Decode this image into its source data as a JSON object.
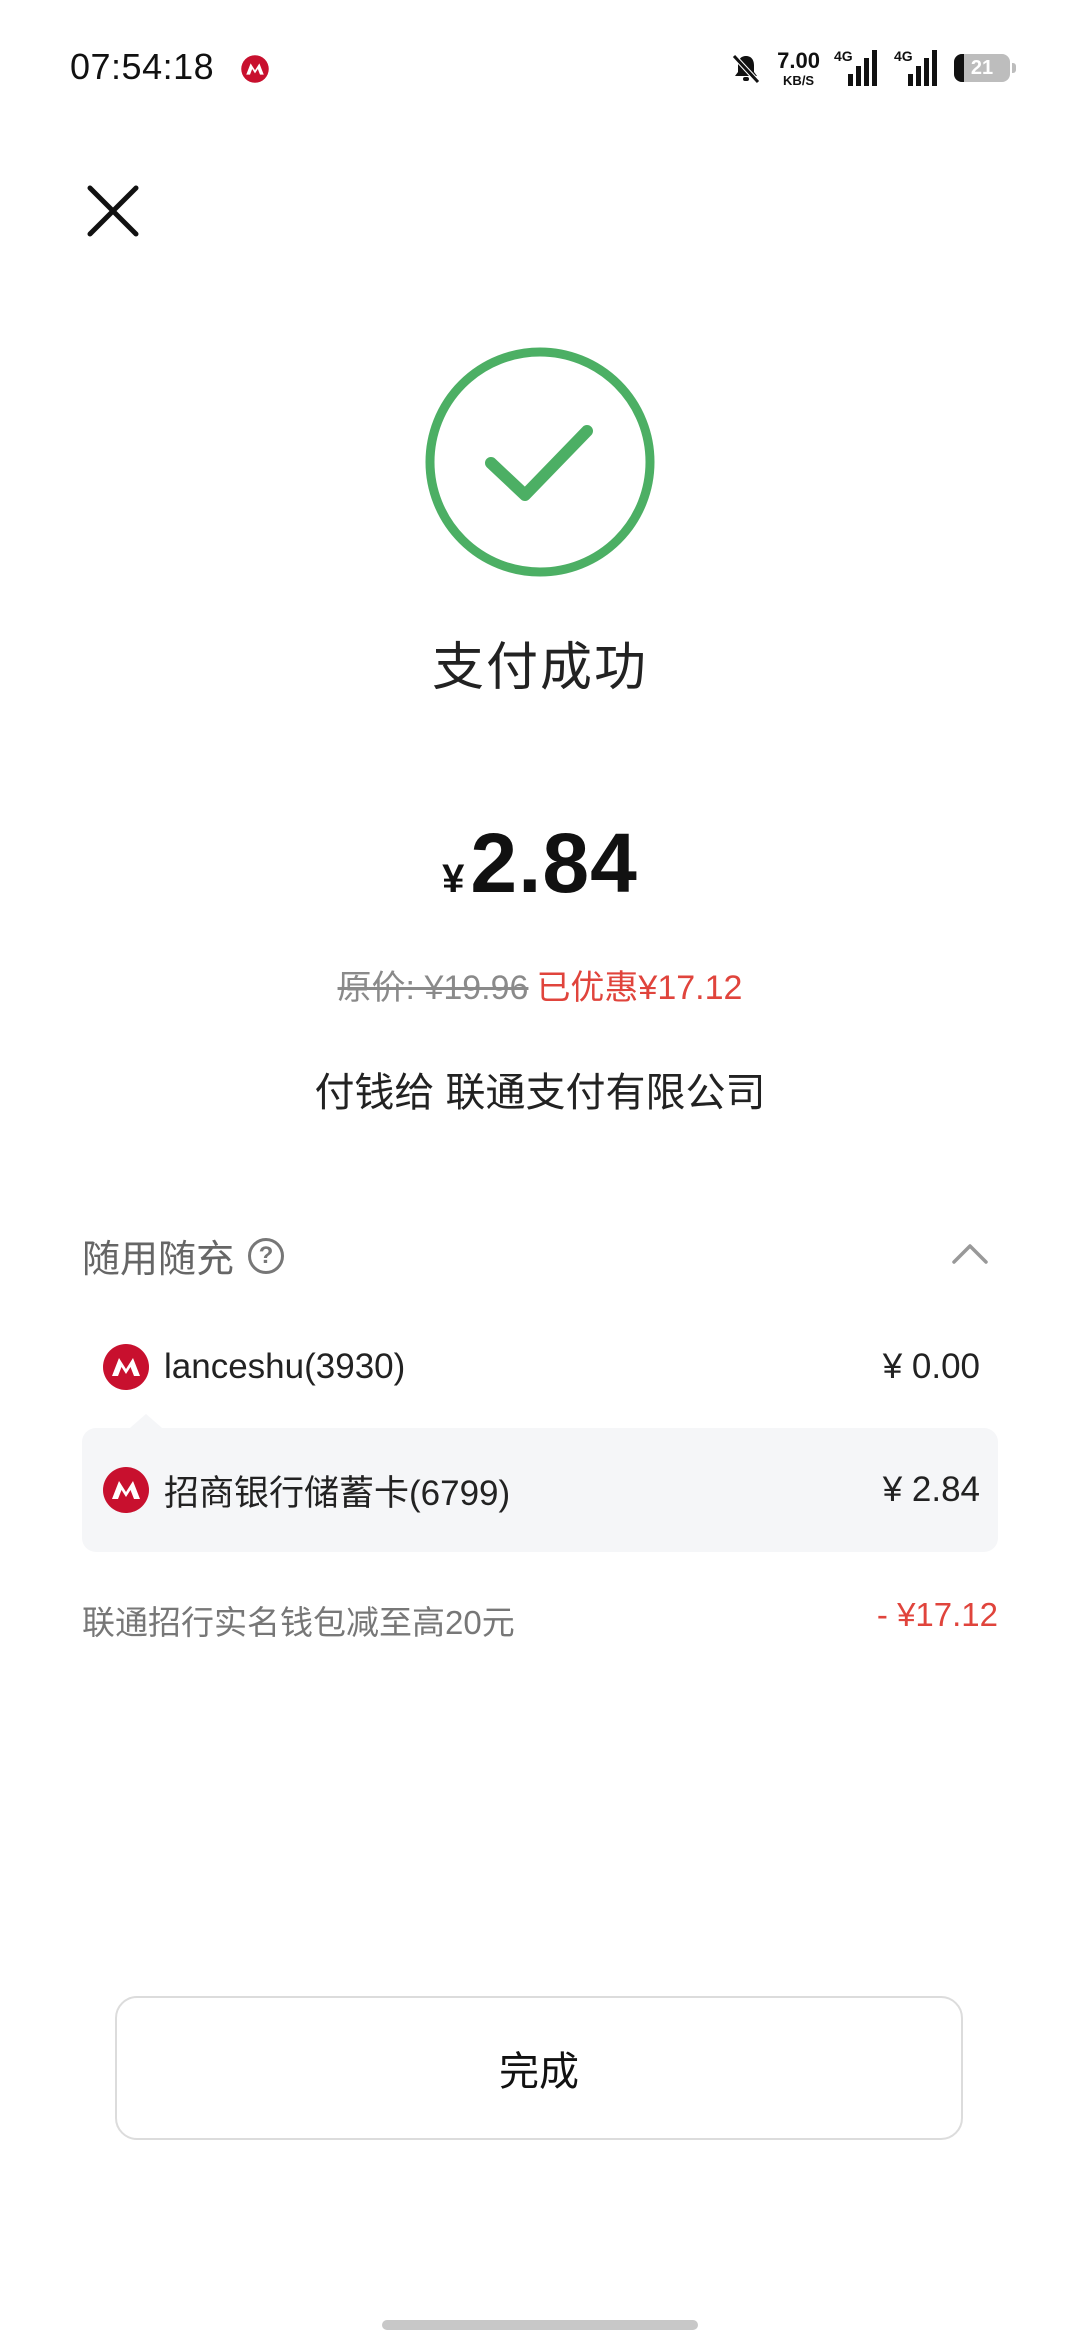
{
  "status_bar": {
    "time": "07:54:18",
    "net_speed_value": "7.00",
    "net_speed_unit": "KB/S",
    "signal1_tag": "4G",
    "signal2_tag": "4G",
    "battery_level": "21",
    "icons": [
      "cmb-logo-icon",
      "bell-muted-icon",
      "signal-icon",
      "signal-icon",
      "battery-icon"
    ]
  },
  "header": {
    "close_icon": "close-icon"
  },
  "result": {
    "icon": "check-circle-icon",
    "title": "支付成功",
    "currency": "¥",
    "amount": "2.84",
    "original_price": "原价: ¥19.96",
    "discount_text": "已优惠¥17.12",
    "payee": "付钱给 联通支付有限公司"
  },
  "payment_section": {
    "title": "随用随充",
    "help_icon": "question-circle-icon",
    "collapse_icon": "chevron-up-icon",
    "methods": [
      {
        "name": "lanceshu(3930)",
        "amount": "¥ 0.00",
        "icon": "cmb-logo-icon"
      },
      {
        "name": "招商银行储蓄卡(6799)",
        "amount": "¥ 2.84",
        "icon": "cmb-logo-icon"
      }
    ],
    "discount_label": "联通招行实名钱包减至高20元",
    "discount_value": "- ¥17.12"
  },
  "footer": {
    "done_label": "完成"
  },
  "colors": {
    "success_green": "#4caf64",
    "discount_red": "#e0443c",
    "cmb_red": "#c8102e",
    "selected_row_bg": "#f5f6f8"
  }
}
